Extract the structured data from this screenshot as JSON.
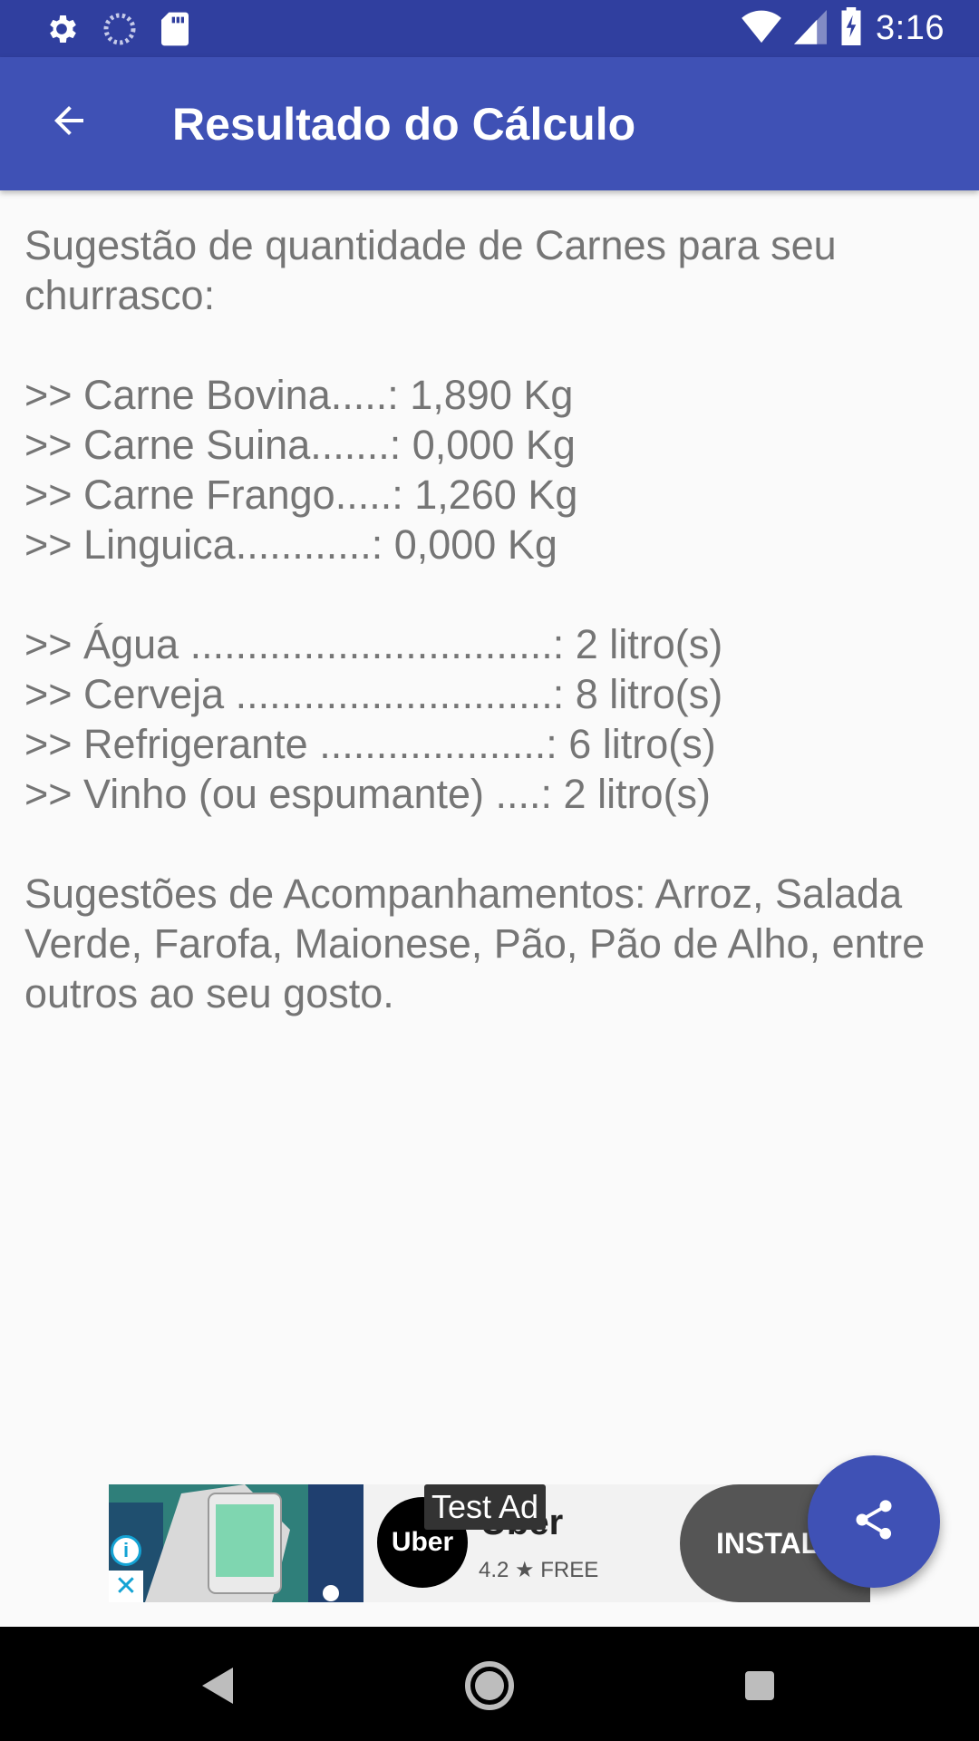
{
  "status_bar": {
    "time": "3:16",
    "icons": [
      "settings-icon",
      "sync-icon",
      "sd-card-icon",
      "wifi-icon",
      "signal-icon",
      "battery-charging-icon"
    ]
  },
  "app_bar": {
    "title": "Resultado do Cálculo",
    "back_icon": "arrow-back-icon"
  },
  "content": {
    "intro": [
      "Sugestão de quantidade de Carnes para seu",
      "churrasco:"
    ],
    "meats": [
      ">> Carne Bovina.....: 1,890 Kg",
      ">> Carne Suina.......: 0,000 Kg",
      ">> Carne Frango.....: 1,260 Kg",
      ">> Linguica............: 0,000 Kg"
    ],
    "drinks": [
      ">> Água ................................: 2 litro(s)",
      ">> Cerveja ............................: 8 litro(s)",
      ">> Refrigerante ....................: 6 litro(s)",
      ">> Vinho (ou espumante) ....: 2 litro(s)"
    ],
    "sides": [
      "Sugestões de Acompanhamentos: Arroz, Salada",
      "Verde, Farofa, Maionese, Pão, Pão de Alho, entre",
      "outros ao seu gosto."
    ]
  },
  "ad": {
    "test_label": "Test Ad",
    "logo_text": "Uber",
    "app_name": "Uber",
    "rating": "4.2 ★ FREE",
    "install_label": "INSTAL",
    "info_icon": "info-icon",
    "close_icon": "close-icon"
  },
  "fab": {
    "icon": "share-icon"
  },
  "nav_bar": {
    "icons": [
      "back-triangle-icon",
      "home-circle-icon",
      "recents-square-icon"
    ]
  }
}
